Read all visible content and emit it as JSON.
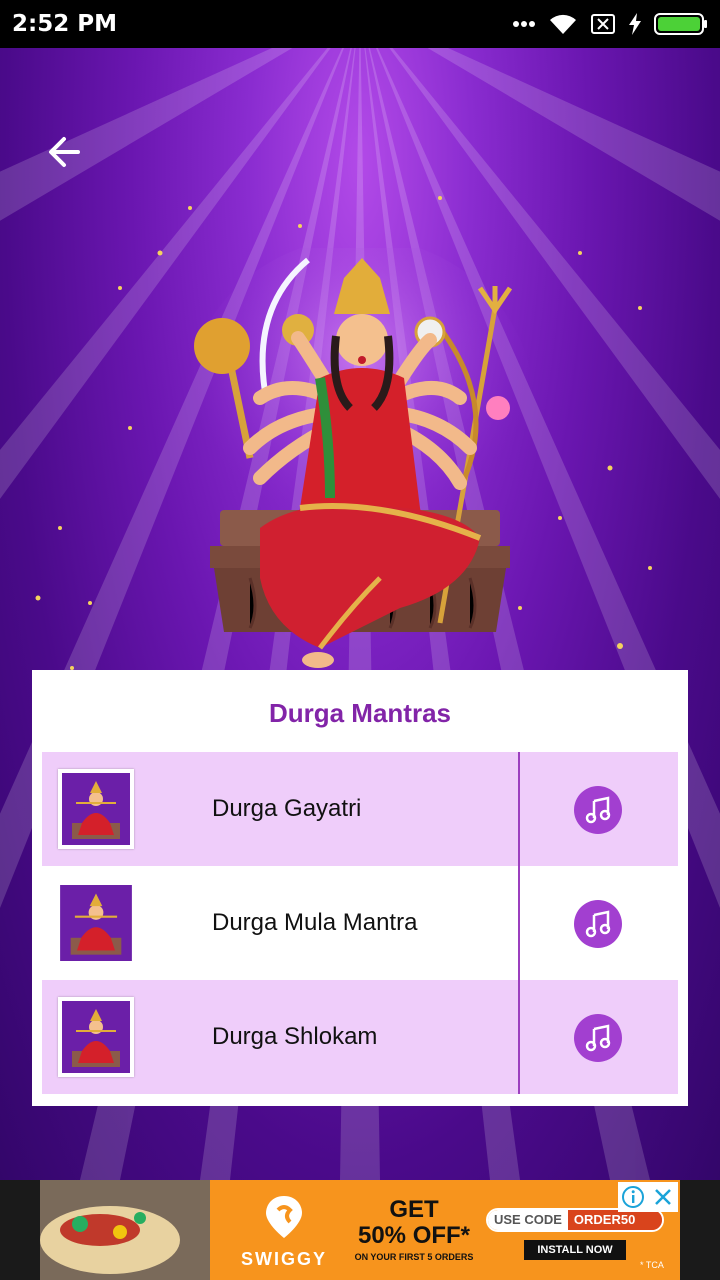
{
  "status_bar": {
    "time": "2:52 PM",
    "icons": [
      "more-dots-icon",
      "wifi-icon",
      "sim-disabled-icon",
      "charging-bolt-icon",
      "battery-icon"
    ]
  },
  "header": {
    "back_icon": "arrow-left-icon"
  },
  "card": {
    "title": "Durga Mantras",
    "items": [
      {
        "label": "Durga Gayatri",
        "icon": "music-note-icon"
      },
      {
        "label": "Durga Mula Mantra",
        "icon": "music-note-icon"
      },
      {
        "label": "Durga Shlokam",
        "icon": "music-note-icon"
      }
    ]
  },
  "ad": {
    "brand": "SWIGGY",
    "headline_1": "GET",
    "headline_2": "50% OFF*",
    "subtext": "ON YOUR FIRST 5 ORDERS",
    "code_label": "USE CODE",
    "code_value": "ORDER50",
    "install": "INSTALL NOW",
    "terms": "* TCA",
    "info_icon": "info-icon",
    "close_icon": "close-icon"
  },
  "colors": {
    "accent": "#8224a8",
    "row_shade": "#efcdfa",
    "music_button": "#a23fd0",
    "ad_orange": "#f7941d"
  }
}
